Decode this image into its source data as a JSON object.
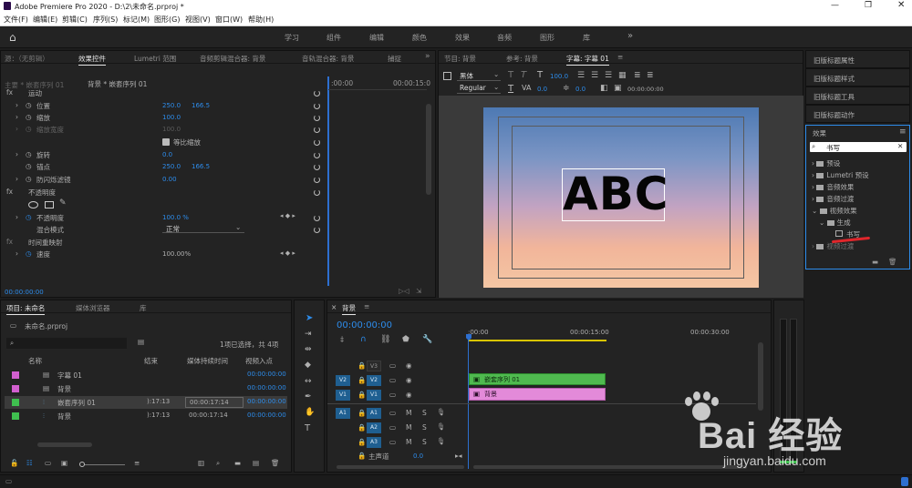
{
  "window": {
    "title": "Adobe Premiere Pro 2020 - D:\\2\\未命名.prproj *",
    "controls": [
      "minimize",
      "maximize",
      "close"
    ]
  },
  "menu": [
    "文件(F)",
    "编辑(E)",
    "剪辑(C)",
    "序列(S)",
    "标记(M)",
    "图形(G)",
    "视图(V)",
    "窗口(W)",
    "帮助(H)"
  ],
  "workspaces": [
    "学习",
    "组件",
    "编辑",
    "颜色",
    "效果",
    "音频",
    "图形",
    "库"
  ],
  "effect_controls": {
    "tabs": [
      "源：（无剪辑）",
      "效果控件",
      "Lumetri 范围",
      "音频剪辑混合器: 背景",
      "音轨混合器: 背景",
      "捕捉"
    ],
    "master": "主要 * 嵌套序列 01",
    "clip": "背景 * 嵌套序列 01",
    "time_start": ":00:00",
    "time_end": "00:00:15:0",
    "motion_section": "运动",
    "opacity_section": "不透明度",
    "timeremap_section": "时间重映射",
    "properties": {
      "position": {
        "label": "位置",
        "x": "250.0",
        "y": "166.5"
      },
      "scale": {
        "label": "缩放",
        "value": "100.0"
      },
      "scale_width": {
        "label": "缩放宽度",
        "value": "100.0"
      },
      "uniform_scale": {
        "label": "等比缩放"
      },
      "rotation": {
        "label": "旋转",
        "value": "0.0"
      },
      "anchor": {
        "label": "锚点",
        "x": "250.0",
        "y": "166.5"
      },
      "antiflicker": {
        "label": "防闪烁滤镜",
        "value": "0.00"
      },
      "opacity": {
        "label": "不透明度",
        "value": "100.0 %"
      },
      "blend_mode": {
        "label": "混合模式",
        "value": "正常"
      },
      "speed": {
        "label": "速度",
        "value": "100.00%"
      }
    },
    "timecode": "00:00:00:00"
  },
  "program": {
    "tabs": [
      "节目: 背景",
      "参考: 背景",
      "字幕: 字幕 01"
    ],
    "font": "黑体",
    "style": "Regular",
    "size": "100.0",
    "kerning": "0.0",
    "leading": "0.0",
    "tc1": "00:00:00:00",
    "tc2": "00:00:00:00",
    "title_text": "ABC"
  },
  "right_panels": [
    "旧版标题属性",
    "旧版标题样式",
    "旧版标题工具",
    "旧版标题动作"
  ],
  "effects_panel": {
    "title": "效果",
    "search_value": "书写",
    "tree": [
      {
        "label": "预设",
        "level": 0
      },
      {
        "label": "Lumetri 预设",
        "level": 0
      },
      {
        "label": "音频效果",
        "level": 0
      },
      {
        "label": "音频过渡",
        "level": 0
      },
      {
        "label": "视频效果",
        "level": 0
      },
      {
        "label": "生成",
        "level": 1
      },
      {
        "label": "书写",
        "level": 2
      },
      {
        "label": "视频过渡",
        "level": 0
      }
    ]
  },
  "project": {
    "tabs": [
      "项目: 未命名",
      "媒体浏览器",
      "库"
    ],
    "file": "未命名.prproj",
    "selection_info": "1项已选择，共 4项",
    "columns": [
      "名称",
      "结束",
      "媒体持续时间",
      "视频入点"
    ],
    "items": [
      {
        "name": "字幕 01",
        "color": "#d25fcf",
        "end": "",
        "duration": "",
        "in": "00:00:00:00"
      },
      {
        "name": "背景",
        "color": "#d25fcf",
        "end": "",
        "duration": "",
        "in": "00:00:00:00"
      },
      {
        "name": "嵌套序列 01",
        "color": "#3fbf4f",
        "end": "):17:13",
        "duration": "00:00:17:14",
        "in": "00:00:00:00"
      },
      {
        "name": "背景",
        "color": "#3fbf4f",
        "end": "):17:13",
        "duration": "00:00:17:14",
        "in": "00:00:00:00"
      }
    ]
  },
  "timeline": {
    "tab": "背景",
    "timecode": "00:00:00:00",
    "ruler": [
      ":00:00",
      "00:00:15:00",
      "00:00:30:00"
    ],
    "tracks": {
      "video": [
        "V3",
        "V2",
        "V1"
      ],
      "audio": [
        "A1",
        "A2",
        "A3"
      ],
      "master": "主声道",
      "master_value": "0.0"
    },
    "clips": [
      {
        "name": "嵌套序列 01",
        "track": "V2",
        "color": "#4fba4f"
      },
      {
        "name": "背景",
        "track": "V1",
        "color": "#e38ad9"
      }
    ]
  },
  "watermark": {
    "brand": "Bai 经验",
    "url": "jingyan.baidu.com"
  }
}
